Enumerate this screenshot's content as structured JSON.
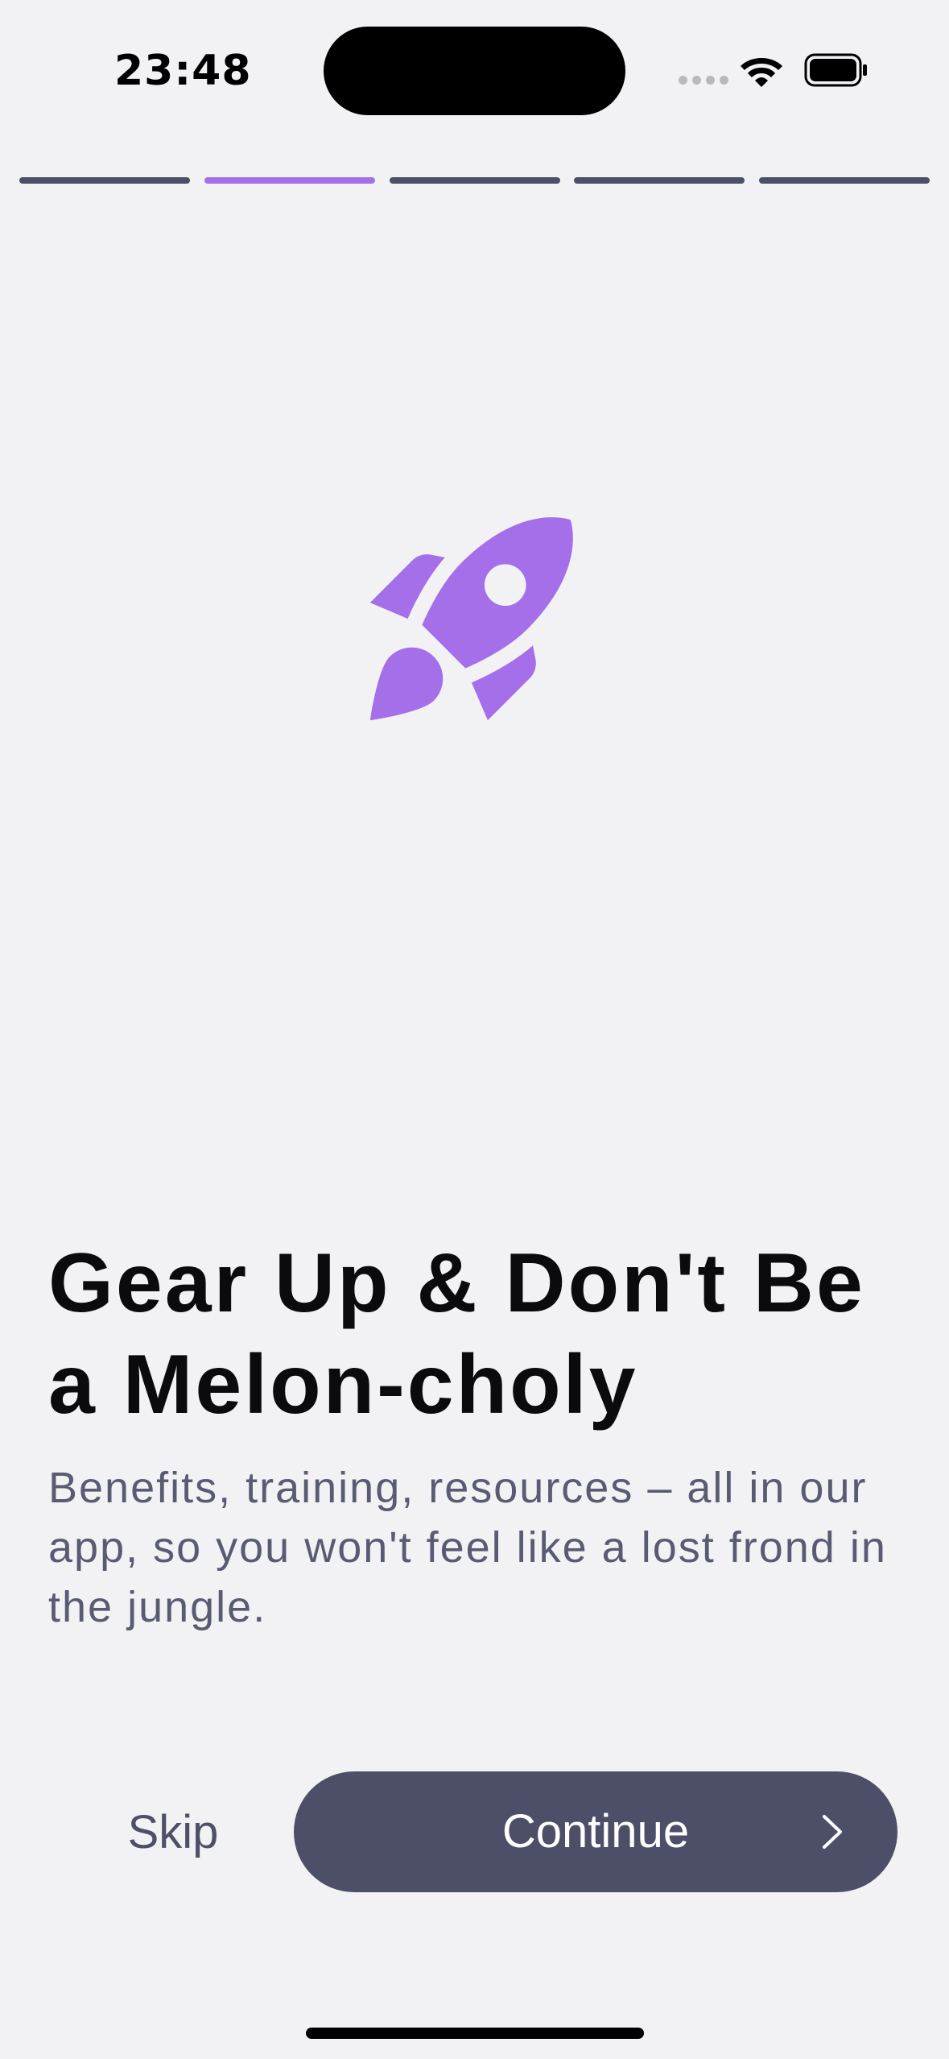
{
  "status_bar": {
    "time": "23:48",
    "icons": [
      "signal-icon",
      "wifi-icon",
      "battery-icon"
    ]
  },
  "progress": {
    "total_steps": 5,
    "current_step": 2
  },
  "hero": {
    "icon": "rocket-icon",
    "color": "#a56fe9"
  },
  "content": {
    "title": "Gear Up & Don't Be a Melon-choly",
    "subtitle": "Benefits, training, resources – all in our app, so you won't feel like a lost frond in the jungle."
  },
  "actions": {
    "skip_label": "Skip",
    "continue_label": "Continue",
    "continue_icon": "chevron-right-icon"
  },
  "colors": {
    "background": "#f2f2f5",
    "accent": "#a56fe9",
    "button": "#4d4f68",
    "inactive_segment": "#4c4f66"
  }
}
